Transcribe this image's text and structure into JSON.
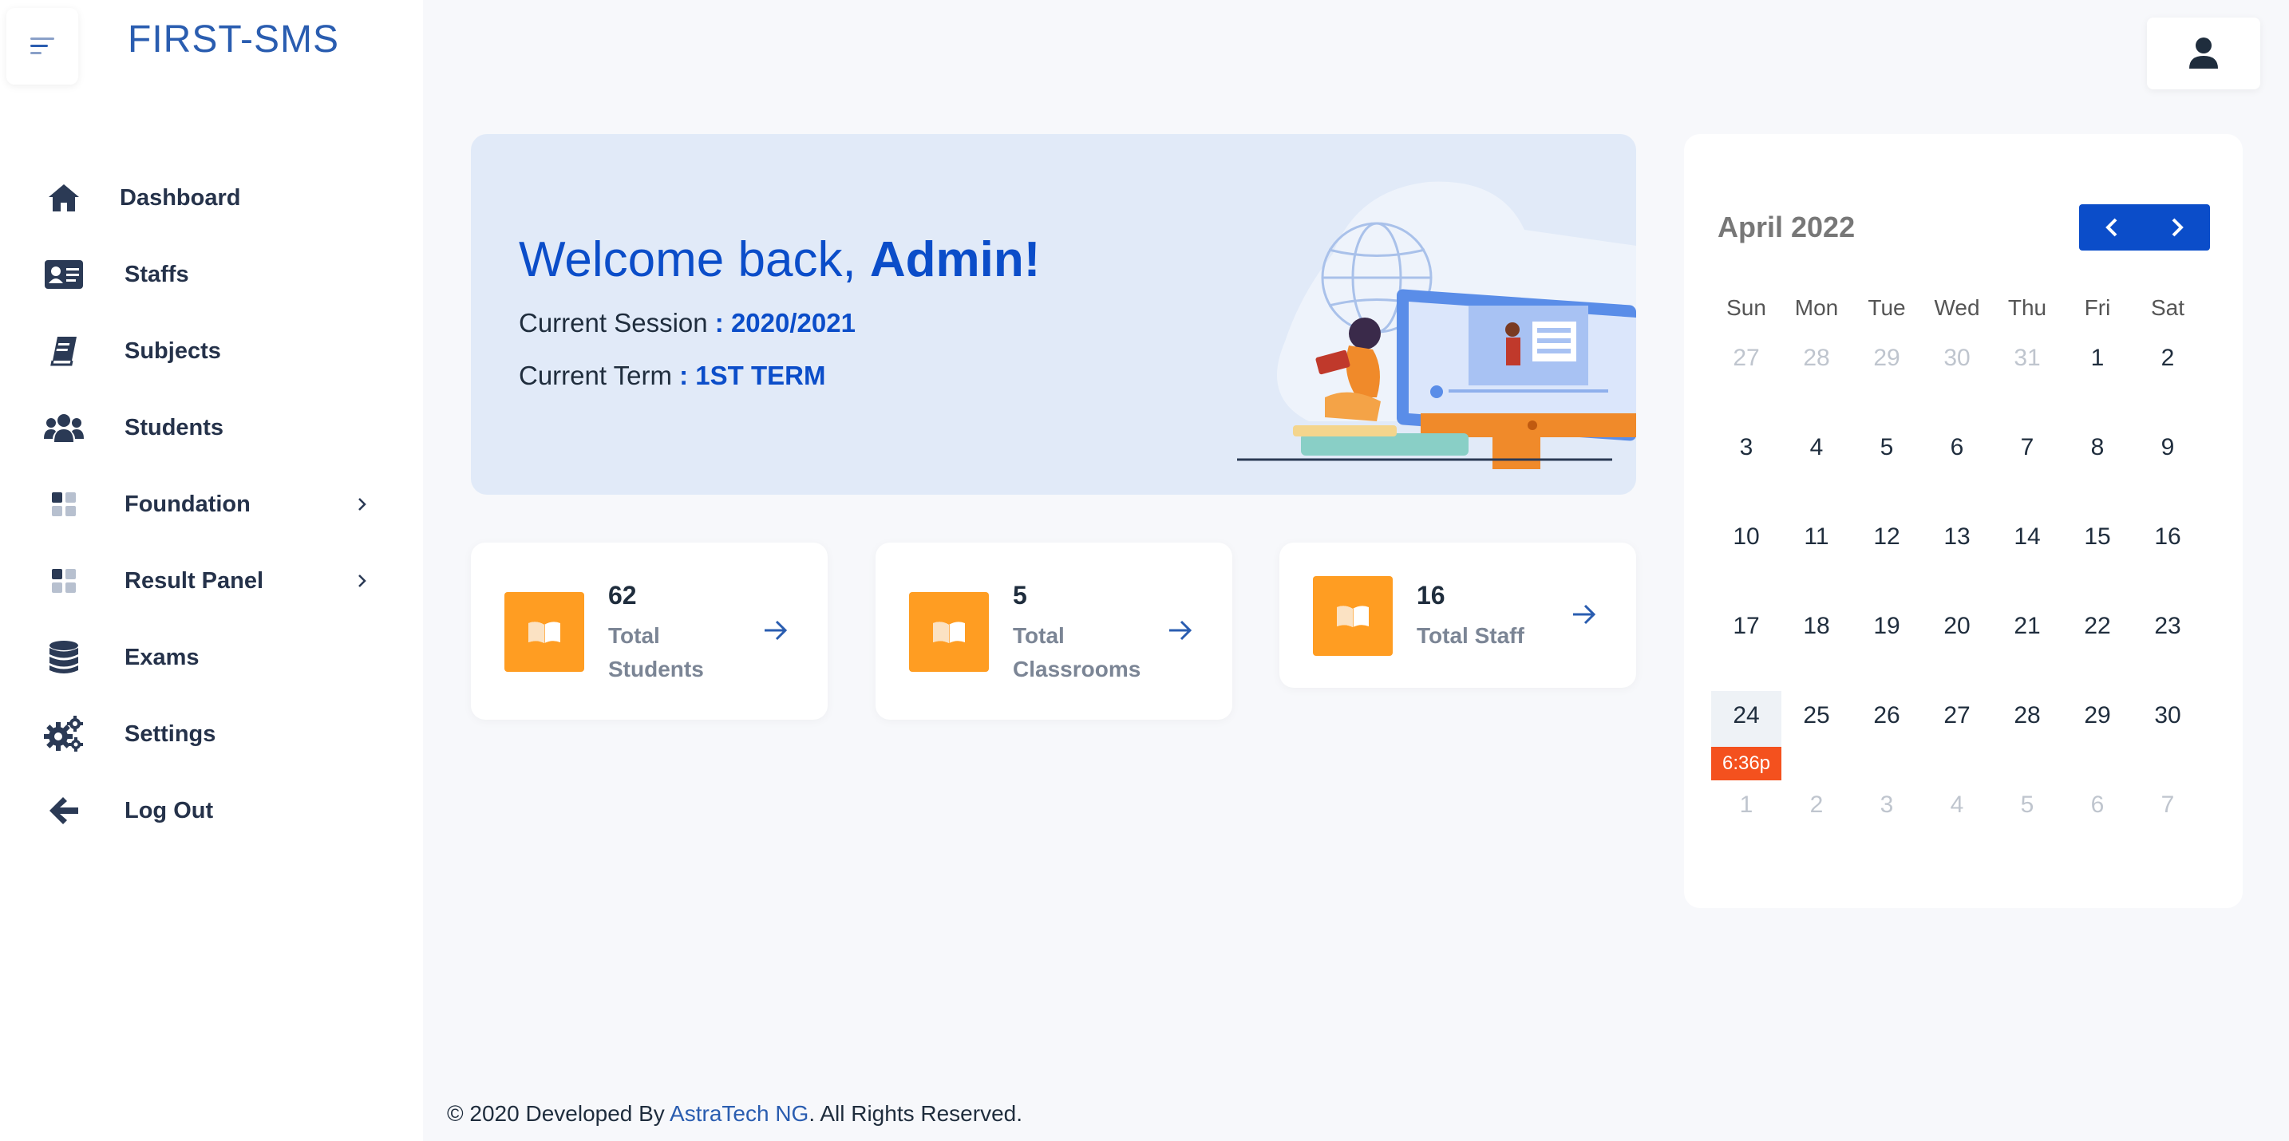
{
  "brand": {
    "name": "FIRST-SMS"
  },
  "sidebar": {
    "items": [
      {
        "label": "Dashboard",
        "icon": "home-icon"
      },
      {
        "label": "Staffs",
        "icon": "id-card-icon"
      },
      {
        "label": "Subjects",
        "icon": "book-icon"
      },
      {
        "label": "Students",
        "icon": "users-icon"
      },
      {
        "label": "Foundation",
        "icon": "grid-icon",
        "has_submenu": true
      },
      {
        "label": "Result Panel",
        "icon": "grid-icon",
        "has_submenu": true
      },
      {
        "label": "Exams",
        "icon": "database-icon"
      },
      {
        "label": "Settings",
        "icon": "gears-icon"
      },
      {
        "label": "Log Out",
        "icon": "arrow-left-icon"
      }
    ]
  },
  "banner": {
    "greeting": "Welcome back, ",
    "user": "Admin!",
    "session_label": "Current Session ",
    "session_value": ": 2020/2021",
    "term_label": "Current Term ",
    "term_value": ": 1ST TERM"
  },
  "stats": [
    {
      "value": "62",
      "label": "Total Students",
      "icon": "book-open-icon"
    },
    {
      "value": "5",
      "label": "Total Classrooms",
      "icon": "book-open-icon"
    },
    {
      "value": "16",
      "label": "Total Staff",
      "icon": "book-open-icon"
    }
  ],
  "calendar": {
    "title": "April 2022",
    "weekdays": [
      "Sun",
      "Mon",
      "Tue",
      "Wed",
      "Thu",
      "Fri",
      "Sat"
    ],
    "weeks": [
      [
        [
          "27",
          true
        ],
        [
          "28",
          true
        ],
        [
          "29",
          true
        ],
        [
          "30",
          true
        ],
        [
          "31",
          true
        ],
        [
          "1",
          false
        ],
        [
          "2",
          false
        ]
      ],
      [
        [
          "3",
          false
        ],
        [
          "4",
          false
        ],
        [
          "5",
          false
        ],
        [
          "6",
          false
        ],
        [
          "7",
          false
        ],
        [
          "8",
          false
        ],
        [
          "9",
          false
        ]
      ],
      [
        [
          "10",
          false
        ],
        [
          "11",
          false
        ],
        [
          "12",
          false
        ],
        [
          "13",
          false
        ],
        [
          "14",
          false
        ],
        [
          "15",
          false
        ],
        [
          "16",
          false
        ]
      ],
      [
        [
          "17",
          false
        ],
        [
          "18",
          false
        ],
        [
          "19",
          false
        ],
        [
          "20",
          false
        ],
        [
          "21",
          false
        ],
        [
          "22",
          false
        ],
        [
          "23",
          false
        ]
      ],
      [
        [
          "24",
          false
        ],
        [
          "25",
          false
        ],
        [
          "26",
          false
        ],
        [
          "27",
          false
        ],
        [
          "28",
          false
        ],
        [
          "29",
          false
        ],
        [
          "30",
          false
        ]
      ],
      [
        [
          "1",
          true
        ],
        [
          "2",
          true
        ],
        [
          "3",
          true
        ],
        [
          "4",
          true
        ],
        [
          "5",
          true
        ],
        [
          "6",
          true
        ],
        [
          "7",
          true
        ]
      ]
    ],
    "today": "24",
    "now_indicator": "6:36p",
    "prev_label": "<",
    "next_label": ">"
  },
  "footer": {
    "prefix": "© 2020 Developed By ",
    "link": "AstraTech NG",
    "suffix": ". All Rights Reserved."
  },
  "colors": {
    "accent": "#0b4dc9",
    "card_icon_bg": "#ff9d22",
    "now_indicator": "#f4511e",
    "banner_bg": "#e1eaf8"
  }
}
